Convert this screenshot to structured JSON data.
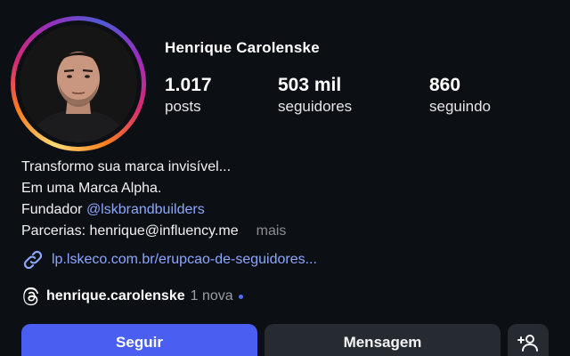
{
  "profile": {
    "name": "Henrique Carolenske",
    "stats": {
      "posts": {
        "value": "1.017",
        "label": "posts"
      },
      "followers": {
        "value": "503 mil",
        "label": "seguidores"
      },
      "following": {
        "value": "860",
        "label": "seguindo"
      }
    },
    "bio": {
      "line1": "Transformo sua marca invisível...",
      "line2": "Em uma Marca Alpha.",
      "line3_prefix": "Fundador ",
      "line3_mention": "@lskbrandbuilders",
      "line4": "Parcerias: henrique@influency.me",
      "more": "mais"
    },
    "link": {
      "icon": "link-icon",
      "text": "lp.lskeco.com.br/erupcao-de-seguidores..."
    },
    "threads": {
      "icon": "threads-icon",
      "handle": "henrique.carolenske",
      "new_label": "1 nova"
    }
  },
  "actions": {
    "follow": "Seguir",
    "message": "Mensagem",
    "add_user_icon": "add-user-icon"
  },
  "colors": {
    "background": "#0c0f14",
    "accent": "#4a5ef1",
    "link": "#8da7ff",
    "secondary_button": "#262a31"
  }
}
